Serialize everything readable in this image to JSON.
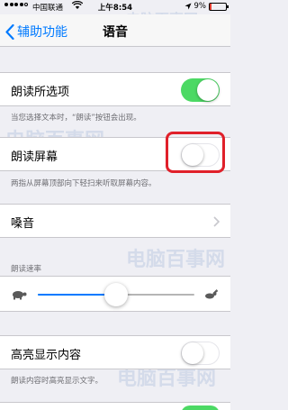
{
  "status_bar": {
    "carrier": "中国联通",
    "time": "上午8:54",
    "battery_percent": "9%",
    "battery_level": 0.09,
    "signal_icon": "signal-dots-icon",
    "wifi_icon": "wifi-icon",
    "battery_icon": "battery-icon"
  },
  "nav": {
    "back_label": "辅助功能",
    "title": "语音"
  },
  "speak_selection": {
    "label": "朗读所选项",
    "enabled": true,
    "footer": "当您选择文本时，“朗读”按钮会出现。"
  },
  "speak_screen": {
    "label": "朗读屏幕",
    "enabled": false,
    "footer": "两指从屏幕顶部向下轻扫来听取屏幕内容。"
  },
  "voices": {
    "label": "嗓音"
  },
  "speaking_rate": {
    "header": "朗读速率",
    "value": 0.5,
    "slow_icon": "turtle-icon",
    "fast_icon": "rabbit-icon"
  },
  "highlight_content": {
    "label": "高亮显示内容",
    "enabled": false,
    "footer": "朗读内容时高亮显示文字。"
  },
  "colors": {
    "accent": "#007aff",
    "toggle_on": "#4cd964",
    "annotation_red": "#e0202a"
  },
  "watermark": {
    "text": "电脑百事网"
  }
}
